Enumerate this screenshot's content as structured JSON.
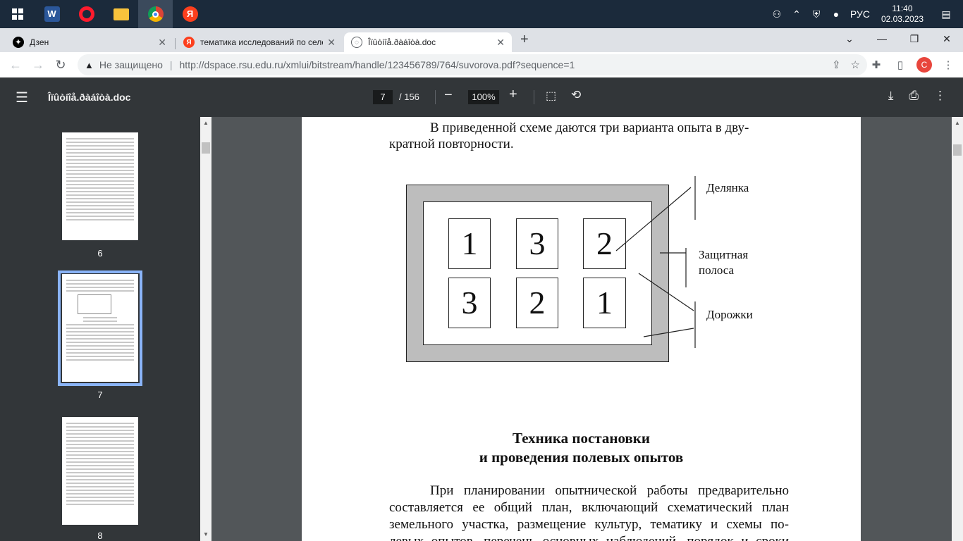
{
  "taskbar": {
    "icons": [
      "windows-start",
      "word",
      "opera",
      "file-explorer",
      "chrome",
      "yandex"
    ],
    "tray": {
      "language": "РУС",
      "time": "11:40",
      "date": "02.03.2023"
    }
  },
  "browser": {
    "tabs": [
      {
        "title": "Дзен",
        "favicon_color": "#000000"
      },
      {
        "title": "тематика исследований по селе",
        "favicon_color": "#fc3f1d"
      },
      {
        "title": "Îïûòíîå.ðàáîòà.doc",
        "favicon_color": "#5f6368"
      }
    ],
    "address": {
      "security_label": "Не защищено",
      "url": "http://dspace.rsu.edu.ru/xmlui/bitstream/handle/123456789/764/suvorova.pdf?sequence=1"
    },
    "profile_initial": "С"
  },
  "pdf_toolbar": {
    "title": "Îïûòíîå.ðàáîòà.doc",
    "current_page": "7",
    "total_pages": "/ 156",
    "zoom": "100%"
  },
  "sidebar": {
    "thumbnails": [
      {
        "page": "6"
      },
      {
        "page": "7",
        "selected": true
      },
      {
        "page": "8"
      }
    ]
  },
  "document": {
    "intro": "В приведенной схеме даются три варианта опыта в дву-кратной повторности.",
    "intro_line1": "В приведенной схеме даются три варианта опыта в дву-",
    "intro_line2": "кратной повторности.",
    "diagram": {
      "plots_row1": [
        "1",
        "3",
        "2"
      ],
      "plots_row2": [
        "3",
        "2",
        "1"
      ],
      "label_plot": "Делянка",
      "label_protective_line1": "Защитная",
      "label_protective_line2": "полоса",
      "label_paths": "Дорожки"
    },
    "heading_line1": "Техника постановки",
    "heading_line2": "и проведения полевых опытов",
    "body_lines": [
      "При планировании опытнической работы предварительно",
      "составляется ее общий план, включающий схематический план",
      "земельного участка, размещение культур, тематику и схемы по-",
      "левых опытов, перечень основных наблюдений, порядок и сроки"
    ]
  }
}
